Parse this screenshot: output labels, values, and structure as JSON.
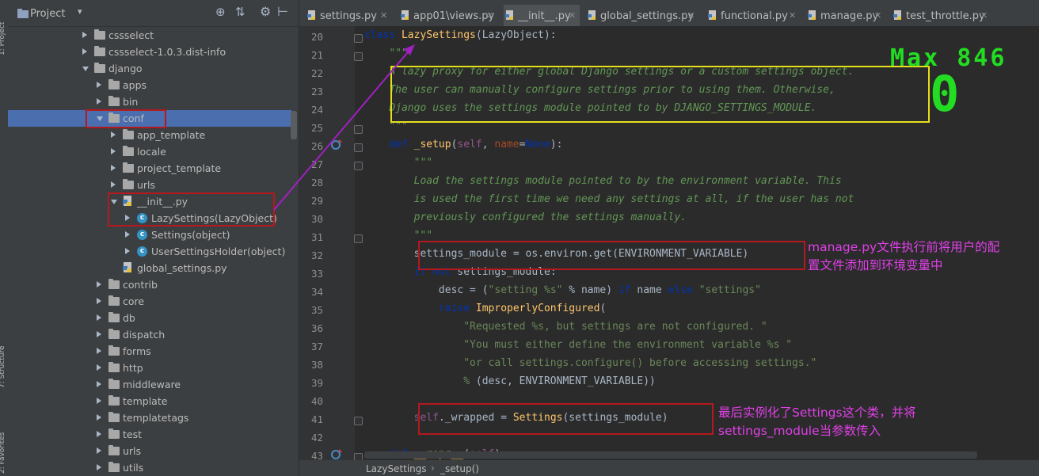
{
  "sidebar": {
    "vertical_tabs": [
      "1: Project",
      "7: Structure",
      "2: Favorites"
    ],
    "title": "Project",
    "tree": [
      {
        "label": "cssselect",
        "icon": "folder-icon",
        "arrow": "collapsed",
        "indent": 1
      },
      {
        "label": "cssselect-1.0.3.dist-info",
        "icon": "folder-icon",
        "arrow": "collapsed",
        "indent": 1
      },
      {
        "label": "django",
        "icon": "folder-icon",
        "arrow": "expanded",
        "indent": 1
      },
      {
        "label": "apps",
        "icon": "folder-icon",
        "arrow": "collapsed",
        "indent": 2
      },
      {
        "label": "bin",
        "icon": "folder-icon",
        "arrow": "collapsed",
        "indent": 2
      },
      {
        "label": "conf",
        "icon": "folder-icon",
        "arrow": "expanded",
        "indent": 2,
        "selected": true
      },
      {
        "label": "app_template",
        "icon": "folder-icon",
        "arrow": "collapsed",
        "indent": 3
      },
      {
        "label": "locale",
        "icon": "folder-icon",
        "arrow": "collapsed",
        "indent": 3
      },
      {
        "label": "project_template",
        "icon": "folder-icon",
        "arrow": "collapsed",
        "indent": 3
      },
      {
        "label": "urls",
        "icon": "folder-icon",
        "arrow": "collapsed",
        "indent": 3
      },
      {
        "label": "__init__.py",
        "icon": "python-file-icon",
        "arrow": "expanded",
        "indent": 3
      },
      {
        "label": "LazySettings(LazyObject)",
        "icon": "class-icon",
        "arrow": "collapsed",
        "indent": 4
      },
      {
        "label": "Settings(object)",
        "icon": "class-icon",
        "arrow": "collapsed",
        "indent": 4
      },
      {
        "label": "UserSettingsHolder(object)",
        "icon": "class-icon",
        "arrow": "collapsed",
        "indent": 4
      },
      {
        "label": "global_settings.py",
        "icon": "python-file-icon",
        "arrow": "none",
        "indent": 3
      },
      {
        "label": "contrib",
        "icon": "folder-icon",
        "arrow": "collapsed",
        "indent": 2
      },
      {
        "label": "core",
        "icon": "folder-icon",
        "arrow": "collapsed",
        "indent": 2
      },
      {
        "label": "db",
        "icon": "folder-icon",
        "arrow": "collapsed",
        "indent": 2
      },
      {
        "label": "dispatch",
        "icon": "folder-icon",
        "arrow": "collapsed",
        "indent": 2
      },
      {
        "label": "forms",
        "icon": "folder-icon",
        "arrow": "collapsed",
        "indent": 2
      },
      {
        "label": "http",
        "icon": "folder-icon",
        "arrow": "collapsed",
        "indent": 2
      },
      {
        "label": "middleware",
        "icon": "folder-icon",
        "arrow": "collapsed",
        "indent": 2
      },
      {
        "label": "template",
        "icon": "folder-icon",
        "arrow": "collapsed",
        "indent": 2
      },
      {
        "label": "templatetags",
        "icon": "folder-icon",
        "arrow": "collapsed",
        "indent": 2
      },
      {
        "label": "test",
        "icon": "folder-icon",
        "arrow": "collapsed",
        "indent": 2
      },
      {
        "label": "urls",
        "icon": "folder-icon",
        "arrow": "collapsed",
        "indent": 2
      },
      {
        "label": "utils",
        "icon": "folder-icon",
        "arrow": "collapsed",
        "indent": 2
      }
    ]
  },
  "tabs": [
    {
      "label": "settings.py",
      "active": false
    },
    {
      "label": "app01\\views.py",
      "active": false
    },
    {
      "label": "__init__.py",
      "active": true
    },
    {
      "label": "global_settings.py",
      "active": false
    },
    {
      "label": "functional.py",
      "active": false
    },
    {
      "label": "manage.py",
      "active": false
    },
    {
      "label": "test_throttle.py",
      "active": false
    }
  ],
  "code": {
    "lines": [
      {
        "n": "20",
        "html": "<span class=\"kwb\">class</span> <span class=\"cls\">LazySettings</span>(LazyObject):"
      },
      {
        "n": "21",
        "html": "    <span class=\"doc\">\"\"\"</span>"
      },
      {
        "n": "22",
        "html": "    <span class=\"doc\">A lazy proxy for either global Django settings or a custom settings object.</span>"
      },
      {
        "n": "23",
        "html": "    <span class=\"doc\">The user can manually configure settings prior to using them. Otherwise,</span>"
      },
      {
        "n": "24",
        "html": "    <span class=\"doc\">Django uses the settings module pointed to by DJANGO_SETTINGS_MODULE.</span>"
      },
      {
        "n": "25",
        "html": "    <span class=\"doc\">\"\"\"</span>"
      },
      {
        "n": "26",
        "html": "    <span class=\"kwb\">def</span> <span class=\"cls\">_setup</span>(<span class=\"self\">self</span>, <span class=\"param\">name</span>=<span class=\"kwb\">None</span>):"
      },
      {
        "n": "27",
        "html": "        <span class=\"doc\">\"\"\"</span>"
      },
      {
        "n": "28",
        "html": "        <span class=\"doc\">Load the settings module pointed to by the environment variable. This</span>"
      },
      {
        "n": "29",
        "html": "        <span class=\"doc\">is used the first time we need any settings at all, if the user has not</span>"
      },
      {
        "n": "30",
        "html": "        <span class=\"doc\">previously configured the settings manually.</span>"
      },
      {
        "n": "31",
        "html": "        <span class=\"doc\">\"\"\"</span>"
      },
      {
        "n": "32",
        "html": "        settings_module = os.environ.get(ENVIRONMENT_VARIABLE)"
      },
      {
        "n": "33",
        "html": "        <span class=\"kwb\">if not</span> settings_module:"
      },
      {
        "n": "34",
        "html": "            desc = (<span class=\"str\">\"setting %s\"</span> % name) <span class=\"kwb\">if</span> name <span class=\"kwb\">else</span> <span class=\"str\">\"settings\"</span>"
      },
      {
        "n": "35",
        "html": "            <span class=\"kwb\">raise</span> <span class=\"cls\">ImproperlyConfigured</span>("
      },
      {
        "n": "36",
        "html": "                <span class=\"str\">\"Requested %s, but settings are not configured. \"</span>"
      },
      {
        "n": "37",
        "html": "                <span class=\"str\">\"You must either define the environment variable %s \"</span>"
      },
      {
        "n": "38",
        "html": "                <span class=\"str\">\"or call settings.configure() before accessing settings.\"</span>"
      },
      {
        "n": "39",
        "html": "                <span class=\"str\">%</span> (desc, ENVIRONMENT_VARIABLE))"
      },
      {
        "n": "40",
        "html": ""
      },
      {
        "n": "41",
        "html": "        <span class=\"self\">self</span>._wrapped = <span class=\"cls\">Settings</span>(settings_module)"
      },
      {
        "n": "42",
        "html": ""
      },
      {
        "n": "43",
        "html": "    <span class=\"kwb\">def</span> <span class=\"cls\">__repr__</span>(<span class=\"self\">self</span>):"
      }
    ]
  },
  "annotations": {
    "note1_line1": "manage.py文件执行前将用户的配",
    "note1_line2": "置文件添加到环境变量中",
    "note2_line1": "最后实例化了Settings这个类，并将",
    "note2_line2": "settings_module当参数传入",
    "max_label": "Max 846",
    "big_zero": "0"
  },
  "breadcrumb": {
    "item1": "LazySettings",
    "sep": "›",
    "item2": "_setup()"
  },
  "colors": {
    "accent": "#4b6eaf",
    "annotation_red": "#b3191f",
    "annotation_yellow": "#e4e01a",
    "annotation_text": "#e040e8",
    "overlay_green": "#22dd22"
  }
}
